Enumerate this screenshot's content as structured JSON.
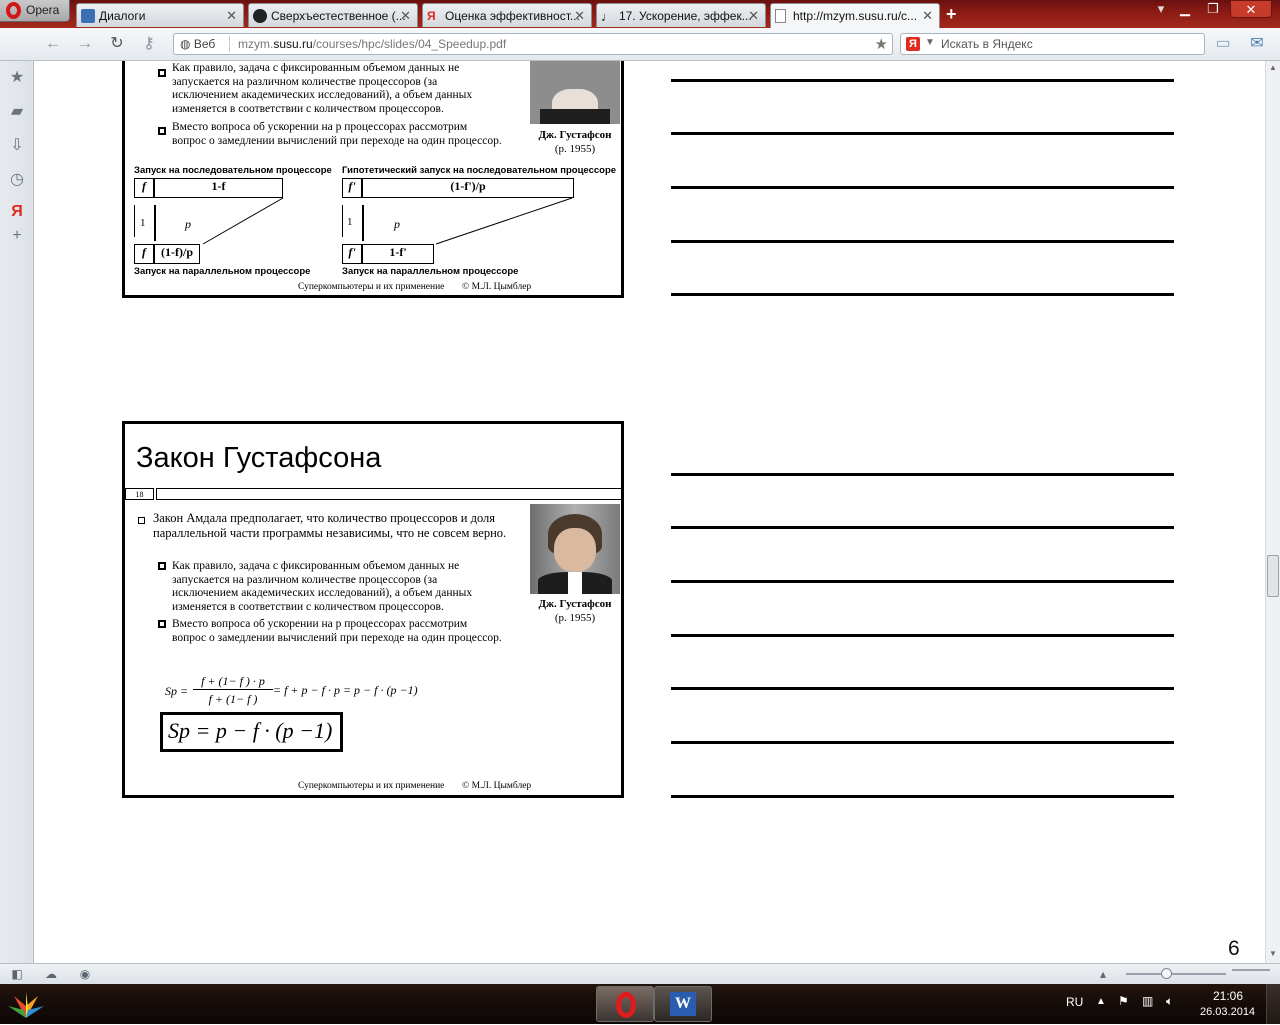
{
  "browser": {
    "menu_label": "Opera",
    "tabs": [
      {
        "label": "Диалоги",
        "icon": "chat-icon"
      },
      {
        "label": "Сверхъестественное (...",
        "icon": "face-icon"
      },
      {
        "label": "Оценка эффективност...",
        "icon": "yandex-icon"
      },
      {
        "label": "17. Ускорение, эффек...",
        "icon": "music-icon"
      },
      {
        "label": "http://mzym.susu.ru/c...",
        "icon": "page-icon"
      }
    ],
    "address": {
      "prefix": "Веб",
      "host_pre": "mzym.",
      "host_main": "susu.ru",
      "path": "/courses/hpc/slides/04_Speedup.pdf"
    },
    "search_placeholder": "Искать в Яндекс"
  },
  "pdf": {
    "slide_top": {
      "bullet2a": "Как правило, задача с фиксированным объемом данных не запускается на различном количестве процессоров (за исключением академических исследований), а объем данных изменяется в соответствии с количеством процессоров.",
      "bullet2b": "Вместо вопроса об ускорении на p процессорах рассмотрим вопрос о замедлении вычислений при переходе на один процессор.",
      "caption_name": "Дж. Густафсон",
      "caption_year": "(р. 1955)",
      "diag_left_top": "Запуск на последовательном процессоре",
      "diag_right_top": "Гипотетический запуск на последовательном процессоре",
      "diag_left_bottom": "Запуск на параллельном процессоре",
      "diag_right_bottom": "Запуск на параллельном процессоре",
      "box_f": "f",
      "box_1f": "1-f",
      "box_fp": "f'",
      "box_1fp_p": "(1-f')/p",
      "lbl_1": "1",
      "lbl_p": "p",
      "box_1f_p": "(1-f)/p",
      "box_1fp": "1-f'",
      "footer_left": "Суперкомпьютеры и их применение",
      "footer_right": "© М.Л. Цымблер"
    },
    "slide_bottom": {
      "title": "Закон Густафсона",
      "number": "18",
      "bullet1": "Закон Амдала предполагает, что количество процессоров и доля параллельной части программы независимы, что не совсем верно.",
      "bullet2a": "Как правило, задача с фиксированным объемом данных не запускается на различном количестве процессоров (за исключением академических исследований), а объем данных изменяется в соответствии с количеством процессоров.",
      "bullet2b": "Вместо вопроса об ускорении на p процессорах рассмотрим вопрос о замедлении вычислений при переходе на один процессор.",
      "caption_name": "Дж. Густафсон",
      "caption_year": "(р. 1955)",
      "formula_lhs": "Sp =",
      "formula_num": "f + (1− f ) · p",
      "formula_den": "f + (1− f )",
      "formula_rhs": "= f + p − f · p = p − f · (p −1)",
      "formula_boxed": "Sp = p − f · (p −1)",
      "footer_left": "Суперкомпьютеры и их применение",
      "footer_right": "© М.Л. Цымблер"
    },
    "page_number": "6"
  },
  "taskbar": {
    "lang": "RU",
    "time": "21:06",
    "date": "26.03.2014"
  }
}
